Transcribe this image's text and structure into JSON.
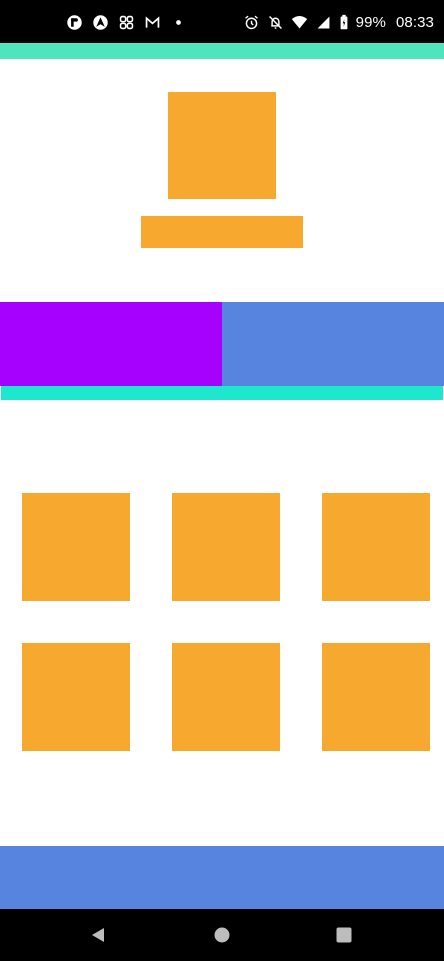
{
  "status_bar": {
    "battery_percent": "99%",
    "time": "08:33",
    "left_icons": [
      "app-notification-icon",
      "navigation-app-icon",
      "pinwheel-app-icon",
      "gmail-icon",
      "dot-icon"
    ],
    "right_icons": [
      "alarm-icon",
      "notifications-off-icon",
      "wifi-icon",
      "cell-signal-icon",
      "battery-icon"
    ]
  },
  "colors": {
    "accent_orange": "#F6A92E",
    "teal_strip": "#4FE3BF",
    "tab_active": "#A600FF",
    "tab_inactive": "#5684DF",
    "tab_indicator": "#1DE7CC",
    "bottom_bar": "#5684DF",
    "system_bars": "#000000"
  },
  "grid": {
    "rows": 2,
    "columns": 3
  },
  "nav_bar": {
    "buttons": [
      "back-icon",
      "home-icon",
      "recents-icon"
    ]
  }
}
